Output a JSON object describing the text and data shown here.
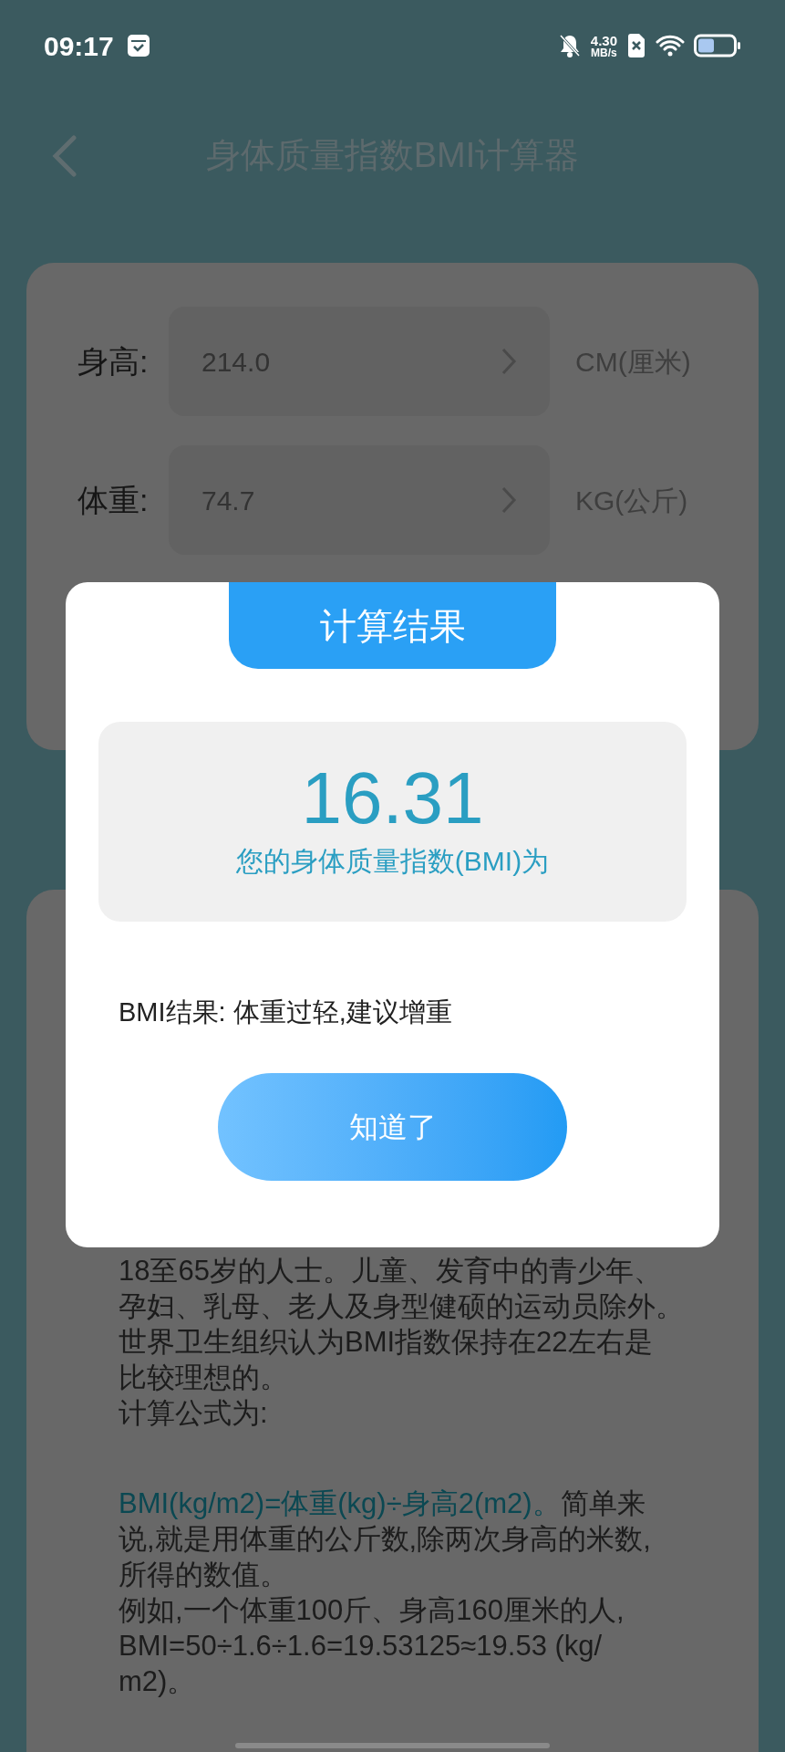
{
  "status_bar": {
    "time": "09:17",
    "speed_value": "4.30",
    "speed_unit": "MB/s"
  },
  "header": {
    "title": "身体质量指数BMI计算器"
  },
  "inputs": [
    {
      "label": "身高:",
      "value": "214.0",
      "unit": "CM(厘米)"
    },
    {
      "label": "体重:",
      "value": "74.7",
      "unit": "KG(公斤)"
    }
  ],
  "info": {
    "lines": [
      "18至65岁的人士。儿童、发育中的青少年、",
      "孕妇、乳母、老人及身型健硕的运动员除外。",
      "世界卫生组织认为BMI指数保持在22左右是",
      "比较理想的。",
      "计算公式为:"
    ],
    "formula_highlight": "BMI(kg/m2)=体重(kg)÷身高2(m2)。",
    "formula_rest": "简单来",
    "formula_lines": [
      "说,就是用体重的公斤数,除两次身高的米数,",
      "所得的数值。",
      "例如,一个体重100斤、身高160厘米的人,",
      "BMI=50÷1.6÷1.6=19.53125≈19.53 (kg/",
      "m2)。"
    ]
  },
  "dialog": {
    "title": "计算结果",
    "bmi": "16.31",
    "caption": "您的身体质量指数(BMI)为",
    "result": "BMI结果: 体重过轻,建议增重",
    "button": "知道了"
  }
}
